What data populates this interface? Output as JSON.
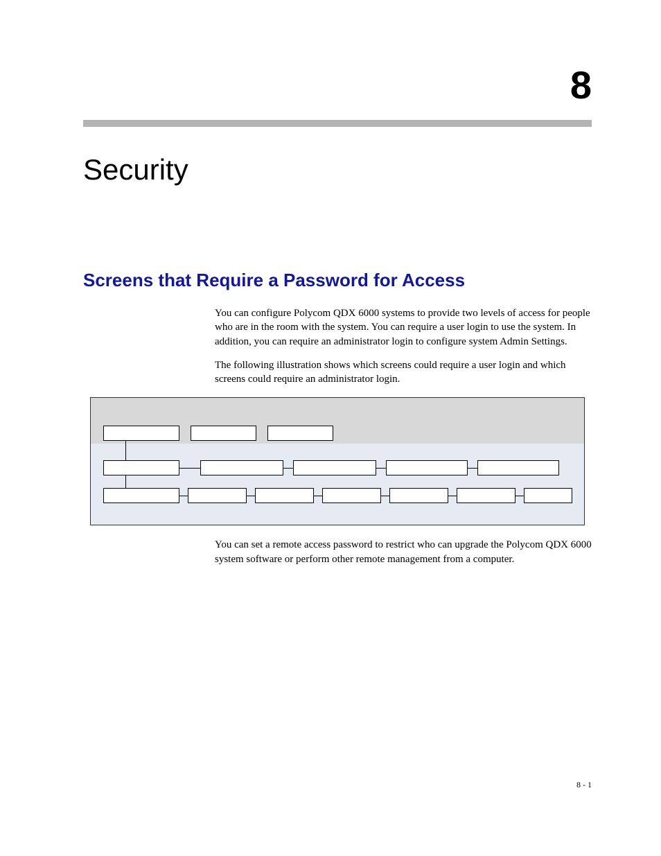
{
  "chapter": {
    "number": "8",
    "title": "Security"
  },
  "section": {
    "title": "Screens that Require a Password for Access"
  },
  "paragraphs": {
    "p1": "You can configure Polycom QDX 6000 systems to provide two levels of access for people who are in the room with the system. You can require a user login to use the system. In addition, you can require an administrator login to configure system Admin Settings.",
    "p2": "The following illustration shows which screens could require a user login and which screens could require an administrator login.",
    "p3": "You can set a remote access password to restrict who can upgrade the Polycom QDX 6000 system software or perform other remote management from a computer."
  },
  "page_number": "8 - 1"
}
